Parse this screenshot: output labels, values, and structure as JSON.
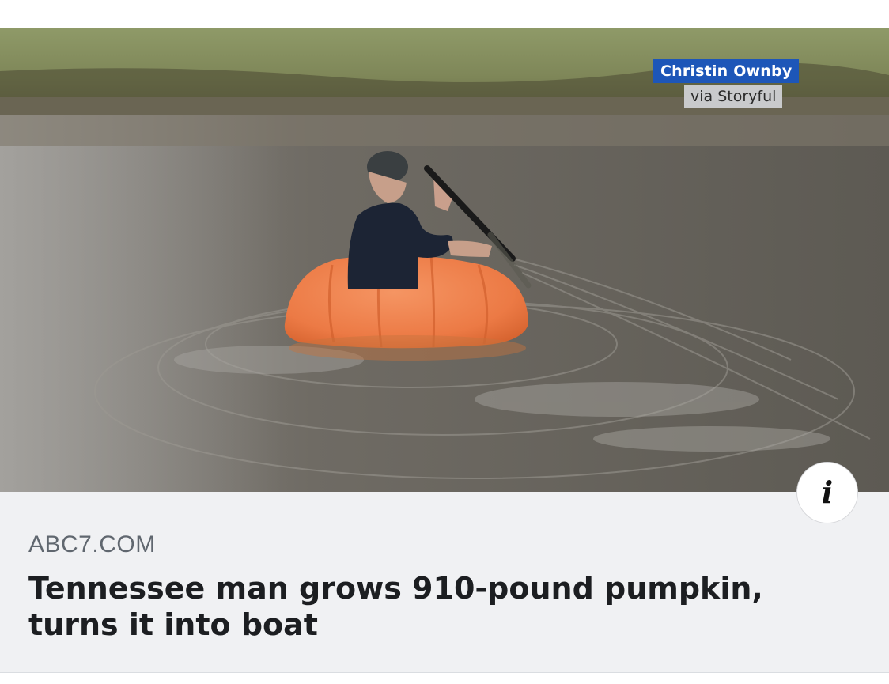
{
  "image": {
    "credit_name": "Christin Ownby",
    "credit_source": "via Storyful"
  },
  "info_button": {
    "glyph": "i",
    "icon": "info-icon"
  },
  "link": {
    "domain": "ABC7.COM",
    "headline": "Tennessee man grows 910-pound pumpkin, turns it into boat"
  },
  "colors": {
    "card_background": "#f0f1f3",
    "credit_badge": "#1d56b8",
    "headline_text": "#1c1e21",
    "domain_text": "#60676f",
    "pumpkin": "#ec7a45"
  }
}
